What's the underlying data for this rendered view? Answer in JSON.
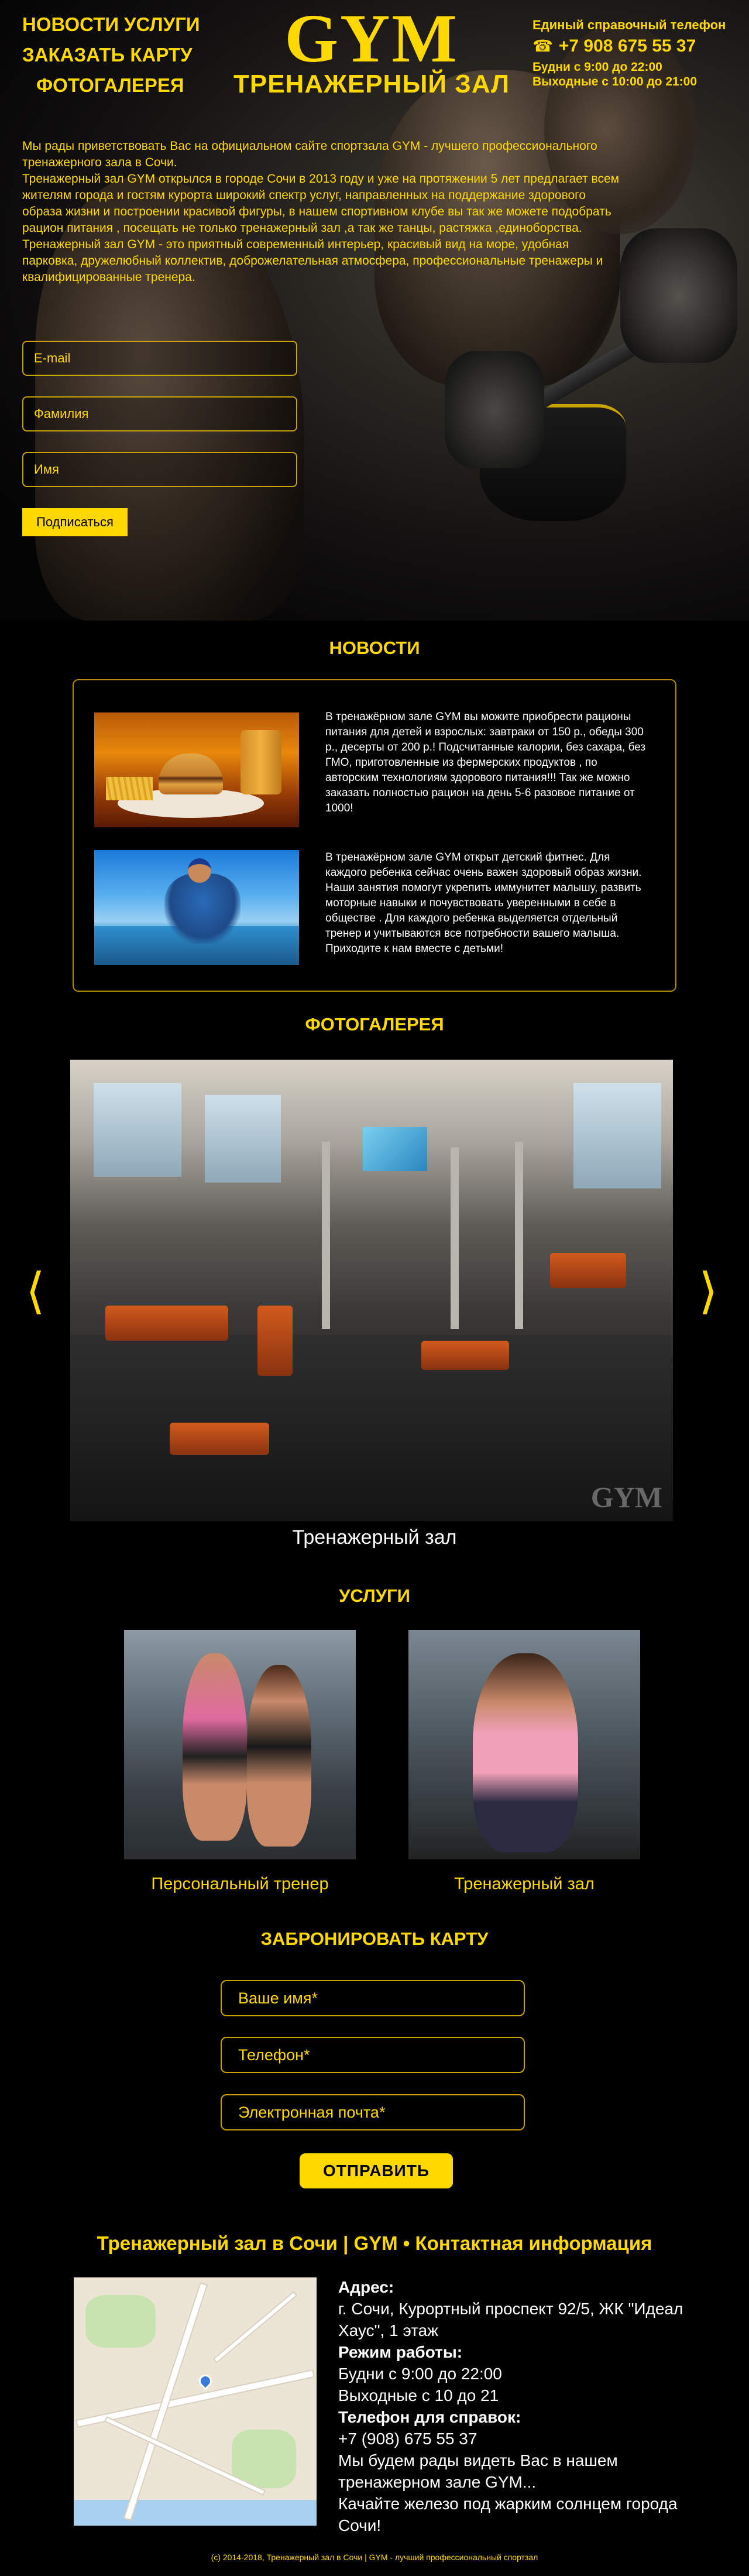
{
  "header": {
    "nav": [
      "НОВОСТИ",
      "УСЛУГИ",
      "ЗАКАЗАТЬ КАРТУ",
      "ФОТОГАЛЕРЕЯ"
    ],
    "logo_main": "GYM",
    "logo_sub": "ТРЕНАЖЕРНЫЙ ЗАЛ",
    "contact_title": "Единый справочный телефон",
    "phone": "+7 908 675 55 37",
    "hours_weekdays": "Будни с 9:00 до 22:00",
    "hours_weekend": "Выходные с 10:00 до 21:00"
  },
  "intro": {
    "paragraphs": [
      "Мы рады приветствовать Вас на официальном сайте спортзала GYM - лучшего профессионального тренажерного зала в Сочи.",
      "Тренажерный зал GYM открылся в городе Сочи в 2013 году и уже на протяжении 5 лет предлагает всем жителям города и гостям курорта широкий спектр услуг, направленных на поддержание здорового образа жизни и построении красивой фигуры, в нашем спортивном клубе вы так же можете подобрать рацион питания , посещать не только тренажерный зал ,а так же танцы, растяжка ,единоборства.",
      "Тренажерный зал GYM - это приятный современный интерьер, красивый вид на море, удобная парковка, дружелюбный коллектив, доброжелательная атмосфера, профессиональные тренажеры и квалифицированные тренера."
    ]
  },
  "subscribe": {
    "email_placeholder": "E-mail",
    "surname_placeholder": "Фамилия",
    "name_placeholder": "Имя",
    "button": "Подписаться"
  },
  "news": {
    "title": "НОВОСТИ",
    "items": [
      {
        "text": "В тренажёрном зале GYM вы можите приобрести рационы питания для детей и взрослых: завтраки от 150 р., обеды 300 р., десерты от 200 р.! Подсчитанные калории, без сахара, без ГМО, приготовленные из фермерских продуктов , по авторским технологиям здорового питания!!! Так же можно заказать полностью рацион на день 5-6 разовое питание от 1000!"
      },
      {
        "text": "В тренажёрном зале GYM открыт детский фитнес. Для каждого ребенка сейчас очень важен здоровый образ жизни. Наши занятия помогут укрепить иммунитет малышу, развить моторные навыки и почувствовать уверенными в себе в обществе . Для каждого ребенка выделяется отдельный тренер и учитываются все потребности вашего малыша. Приходите к нам вместе с детьми!"
      }
    ]
  },
  "gallery": {
    "title": "ФОТОГАЛЕРЕЯ",
    "caption": "Тренажерный зал",
    "prev_icon": "chevron-left-icon",
    "next_icon": "chevron-right-icon",
    "watermark": "GYM"
  },
  "services": {
    "title": "УСЛУГИ",
    "items": [
      {
        "label": "Персональный тренер"
      },
      {
        "label": "Тренажерный зал"
      }
    ]
  },
  "booking": {
    "title": "ЗАБРОНИРОВАТЬ КАРТУ",
    "name_placeholder": "Ваше имя*",
    "phone_placeholder": "Телефон*",
    "email_placeholder": "Электронная почта*",
    "submit": "ОТПРАВИТЬ"
  },
  "contact": {
    "title": "Тренажерный зал в Сочи | GYM • Контактная информация",
    "address_label": "Адрес:",
    "address": "г. Сочи, Курортный проспект 92/5, ЖК \"Идеал Хаус\", 1 этаж",
    "hours_label": "Режим работы:",
    "hours_weekdays": "Будни с 9:00 до 22:00",
    "hours_weekend": "Выходные с 10 до 21",
    "phone_label": "Телефон для справок:",
    "phone": "+7 (908) 675 55 37",
    "welcome": "Мы будем рады видеть Вас в нашем тренажерном зале GYM...",
    "slogan": "Качайте железо под жарким солнцем города Сочи!"
  },
  "footer": {
    "text": "(c) 2014-2018, Тренажерный зал в Сочи | GYM - лучший профессиональный спортзал"
  },
  "colors": {
    "accent": "#ffd800",
    "background": "#000000"
  }
}
